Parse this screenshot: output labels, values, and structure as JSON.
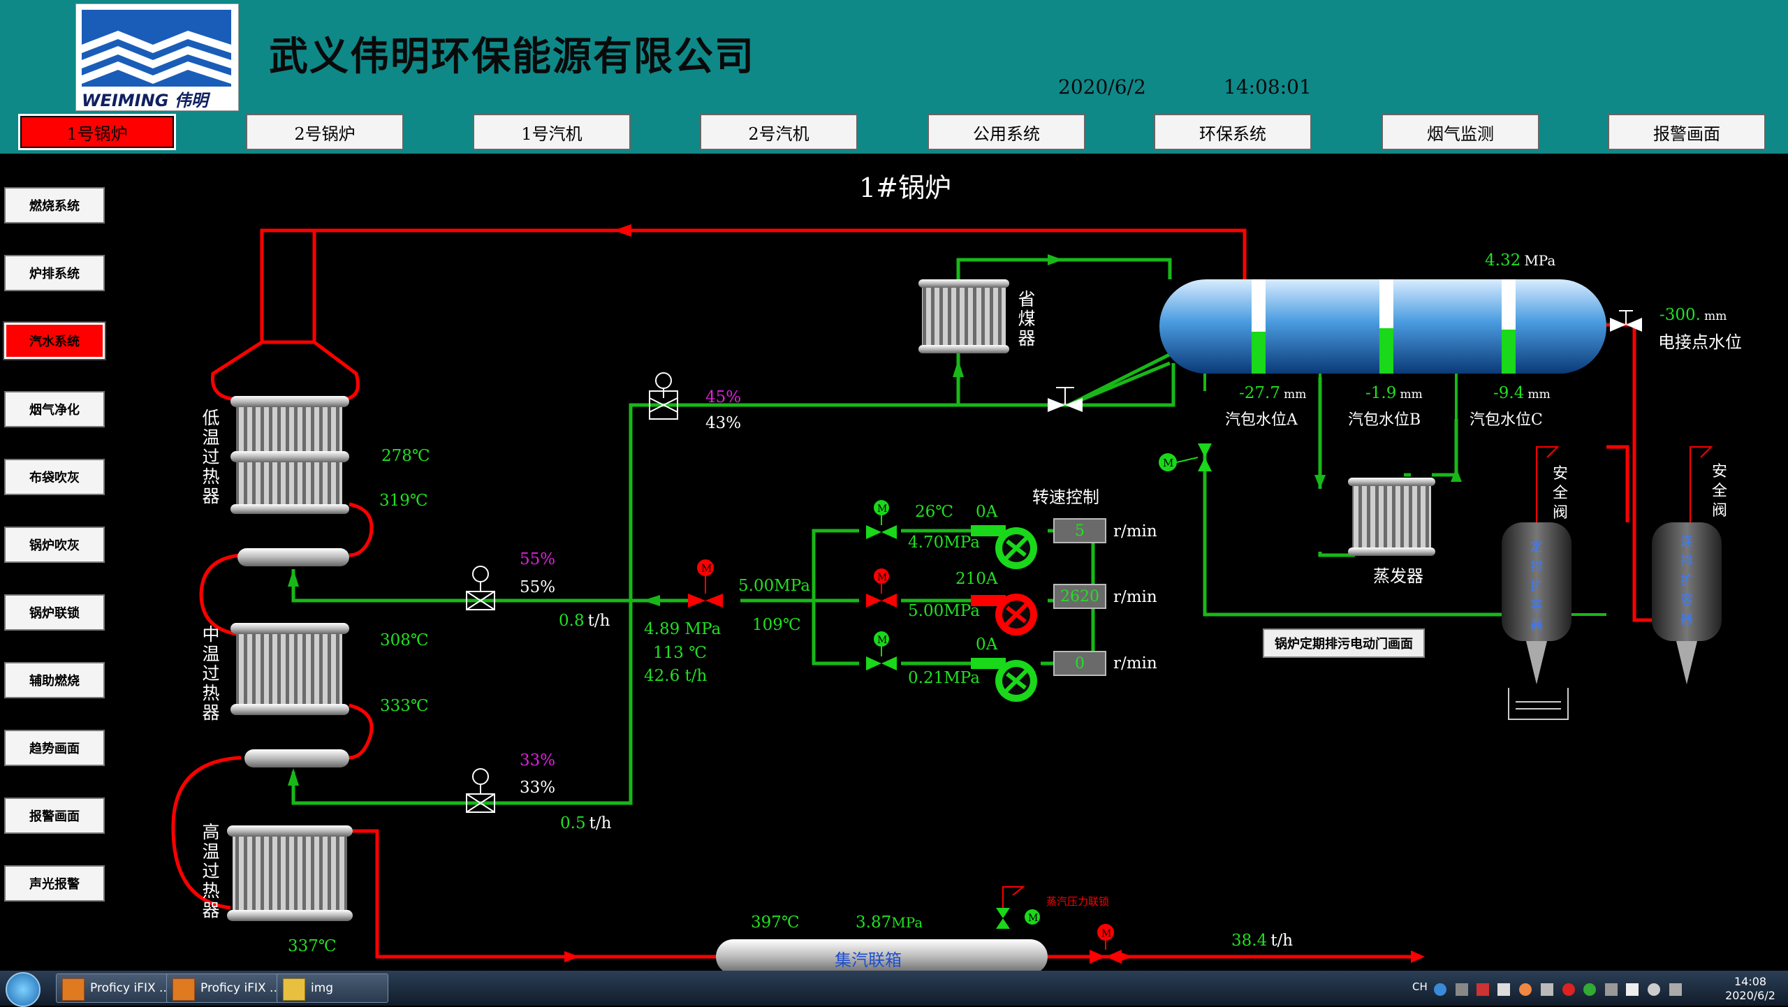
{
  "header": {
    "company": "武义伟明环保能源有限公司",
    "logo_text": "WEIMING 伟明",
    "date": "2020/6/2",
    "time": "14:08:01"
  },
  "top_nav": [
    {
      "label": "1号锅炉",
      "active": true
    },
    {
      "label": "2号锅炉"
    },
    {
      "label": "1号汽机"
    },
    {
      "label": "2号汽机"
    },
    {
      "label": "公用系统"
    },
    {
      "label": "环保系统"
    },
    {
      "label": "烟气监测"
    },
    {
      "label": "报警画面"
    }
  ],
  "side_nav": [
    {
      "label": "燃烧系统"
    },
    {
      "label": "炉排系统"
    },
    {
      "label": "汽水系统",
      "active": true
    },
    {
      "label": "烟气净化"
    },
    {
      "label": "布袋吹灰"
    },
    {
      "label": "锅炉吹灰"
    },
    {
      "label": "锅炉联锁"
    },
    {
      "label": "辅助燃烧"
    },
    {
      "label": "趋势画面"
    },
    {
      "label": "报警画面"
    },
    {
      "label": "声光报警"
    }
  ],
  "page_title": "1#锅炉",
  "superheaters": {
    "low": {
      "label": "低温过热器",
      "in_temp": "278℃",
      "out_temp": "319℃"
    },
    "mid": {
      "label": "中温过热器",
      "in_temp": "308℃",
      "out_temp": "333℃"
    },
    "high": {
      "label": "高温过热器",
      "out_temp": "337℃"
    }
  },
  "economizer": {
    "label": "省煤器"
  },
  "feed_valve": {
    "setpoint": "45%",
    "position": "43%"
  },
  "desuper1": {
    "setpoint": "55%",
    "position": "55%",
    "flow_value": "0.8",
    "flow_unit": "t/h"
  },
  "desuper2": {
    "setpoint": "33%",
    "position": "33%",
    "flow_value": "0.5",
    "flow_unit": "t/h"
  },
  "feedwater": {
    "pressure": "4.89 MPa",
    "temp": "113 ℃",
    "flow": "42.6 t/h",
    "header_pressure": "5.00MPa",
    "header_temp": "109℃"
  },
  "pumps": {
    "title": "转速控制",
    "unit": "r/min",
    "p1": {
      "temp": "26℃",
      "current": "0A",
      "pressure": "4.70MPa",
      "speed": "5"
    },
    "p2": {
      "current": "210A",
      "pressure": "5.00MPa",
      "speed": "2620"
    },
    "p3": {
      "current": "0A",
      "pressure": "0.21MPa",
      "speed": "0"
    }
  },
  "drum": {
    "pressure_value": "4.32",
    "pressure_unit": "MPa",
    "levelA": {
      "value": "-27.7",
      "unit": "mm",
      "label": "汽包水位A"
    },
    "levelB": {
      "value": "-1.9",
      "unit": "mm",
      "label": "汽包水位B"
    },
    "levelC": {
      "value": "-9.4",
      "unit": "mm",
      "label": "汽包水位C"
    },
    "elec_value": "-300.",
    "elec_unit": "mm",
    "elec_label": "电接点水位"
  },
  "evaporator": {
    "label": "蒸发器"
  },
  "safety1": {
    "label": "安全阀"
  },
  "safety2": {
    "label": "安全阀"
  },
  "tank1": {
    "label": "定排扩容器"
  },
  "tank2": {
    "label": "连排扩容器"
  },
  "drain_button": "锅炉定期排污电动门画面",
  "steam_header": {
    "label": "集汽联箱",
    "temp": "397℃",
    "pressure_value": "3.87",
    "pressure_unit": "MPa",
    "interlock": "蒸汽压力联锁",
    "flow_value": "38.4",
    "flow_unit": "t/h"
  },
  "valve_m": "M",
  "taskbar": {
    "items": [
      "Proficy iFIX ...",
      "Proficy iFIX ...",
      "img"
    ],
    "lang": "CH",
    "clock_time": "14:08",
    "clock_date": "2020/6/2"
  },
  "colors": {
    "steam_pipe": "#ff0000",
    "water_pipe": "#18b818",
    "header_bg": "#0f8888"
  }
}
